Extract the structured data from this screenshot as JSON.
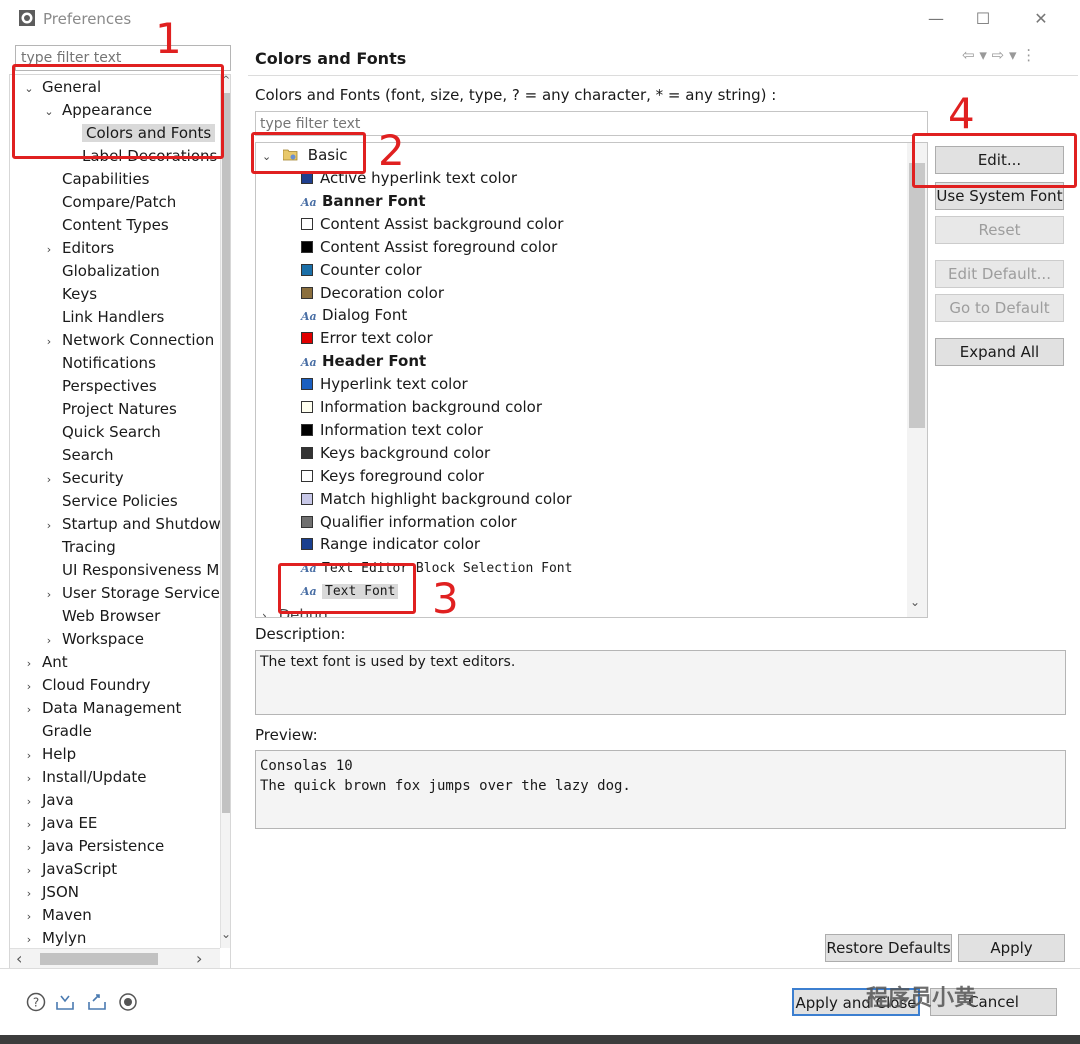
{
  "window": {
    "title": "Preferences",
    "minimize_glyph": "—",
    "maximize_glyph": "☐",
    "close_glyph": "✕",
    "icon": "eclipse-icon"
  },
  "left": {
    "filter_placeholder": "type filter text",
    "tree": [
      {
        "label": "General",
        "depth": 0,
        "toggle": "⌄"
      },
      {
        "label": "Appearance",
        "depth": 1,
        "toggle": "⌄"
      },
      {
        "label": "Colors and Fonts",
        "depth": 2,
        "toggle": "",
        "selected": true
      },
      {
        "label": "Label Decorations",
        "depth": 2,
        "toggle": ""
      },
      {
        "label": "Capabilities",
        "depth": 1,
        "toggle": ""
      },
      {
        "label": "Compare/Patch",
        "depth": 1,
        "toggle": ""
      },
      {
        "label": "Content Types",
        "depth": 1,
        "toggle": ""
      },
      {
        "label": "Editors",
        "depth": 1,
        "toggle": "›"
      },
      {
        "label": "Globalization",
        "depth": 1,
        "toggle": ""
      },
      {
        "label": "Keys",
        "depth": 1,
        "toggle": ""
      },
      {
        "label": "Link Handlers",
        "depth": 1,
        "toggle": ""
      },
      {
        "label": "Network Connection",
        "depth": 1,
        "toggle": "›"
      },
      {
        "label": "Notifications",
        "depth": 1,
        "toggle": ""
      },
      {
        "label": "Perspectives",
        "depth": 1,
        "toggle": ""
      },
      {
        "label": "Project Natures",
        "depth": 1,
        "toggle": ""
      },
      {
        "label": "Quick Search",
        "depth": 1,
        "toggle": ""
      },
      {
        "label": "Search",
        "depth": 1,
        "toggle": ""
      },
      {
        "label": "Security",
        "depth": 1,
        "toggle": "›"
      },
      {
        "label": "Service Policies",
        "depth": 1,
        "toggle": ""
      },
      {
        "label": "Startup and Shutdow",
        "depth": 1,
        "toggle": "›"
      },
      {
        "label": "Tracing",
        "depth": 1,
        "toggle": ""
      },
      {
        "label": "UI Responsiveness M",
        "depth": 1,
        "toggle": ""
      },
      {
        "label": "User Storage Service",
        "depth": 1,
        "toggle": "›"
      },
      {
        "label": "Web Browser",
        "depth": 1,
        "toggle": ""
      },
      {
        "label": "Workspace",
        "depth": 1,
        "toggle": "›"
      },
      {
        "label": "Ant",
        "depth": 0,
        "toggle": "›"
      },
      {
        "label": "Cloud Foundry",
        "depth": 0,
        "toggle": "›"
      },
      {
        "label": "Data Management",
        "depth": 0,
        "toggle": "›"
      },
      {
        "label": "Gradle",
        "depth": 0,
        "toggle": ""
      },
      {
        "label": "Help",
        "depth": 0,
        "toggle": "›"
      },
      {
        "label": "Install/Update",
        "depth": 0,
        "toggle": "›"
      },
      {
        "label": "Java",
        "depth": 0,
        "toggle": "›"
      },
      {
        "label": "Java EE",
        "depth": 0,
        "toggle": "›"
      },
      {
        "label": "Java Persistence",
        "depth": 0,
        "toggle": "›"
      },
      {
        "label": "JavaScript",
        "depth": 0,
        "toggle": "›"
      },
      {
        "label": "JSON",
        "depth": 0,
        "toggle": "›"
      },
      {
        "label": "Maven",
        "depth": 0,
        "toggle": "›"
      },
      {
        "label": "Mylyn",
        "depth": 0,
        "toggle": "›"
      }
    ],
    "scroll_up": "^",
    "scroll_down": "⌄",
    "scroll_left": "‹",
    "scroll_right": "›"
  },
  "main": {
    "title": "Colors and Fonts",
    "nav_glyphs": "⇦ ▾ ⇨ ▾ ⋮",
    "label": "Colors and Fonts (font, size, type, ? = any character, * = any string) :",
    "filter_placeholder": "type filter text",
    "category": {
      "label": "Basic",
      "toggle": "⌄",
      "icon": "folder-icon"
    },
    "items": [
      {
        "label": "Active hyperlink text color",
        "kind": "color",
        "color": "#1f3f8f"
      },
      {
        "label": "Banner Font",
        "kind": "font",
        "bold": true
      },
      {
        "label": "Content Assist background color",
        "kind": "color",
        "color": "#ffffff"
      },
      {
        "label": "Content Assist foreground color",
        "kind": "color",
        "color": "#000000"
      },
      {
        "label": "Counter color",
        "kind": "color",
        "color": "#1a6fa8"
      },
      {
        "label": "Decoration color",
        "kind": "color",
        "color": "#8b6f3e"
      },
      {
        "label": "Dialog Font",
        "kind": "font"
      },
      {
        "label": "Error text color",
        "kind": "color",
        "color": "#e00000"
      },
      {
        "label": "Header Font",
        "kind": "font",
        "bold": true
      },
      {
        "label": "Hyperlink text color",
        "kind": "color",
        "color": "#1b5fc0"
      },
      {
        "label": "Information background color",
        "kind": "color",
        "color": "#fffff0"
      },
      {
        "label": "Information text color",
        "kind": "color",
        "color": "#000000"
      },
      {
        "label": "Keys background color",
        "kind": "color",
        "color": "#333333"
      },
      {
        "label": "Keys foreground color",
        "kind": "color",
        "color": "#ffffff"
      },
      {
        "label": "Match highlight background color",
        "kind": "color",
        "color": "#c8c8e8"
      },
      {
        "label": "Qualifier information color",
        "kind": "color",
        "color": "#707070"
      },
      {
        "label": "Range indicator color",
        "kind": "color",
        "color": "#1a3f8f"
      },
      {
        "label": "Text Editor Block Selection Font",
        "kind": "font",
        "mono": true
      },
      {
        "label": "Text Font",
        "kind": "font",
        "mono": true,
        "selected": true
      }
    ],
    "next_category": {
      "label": "Debug",
      "toggle": "›"
    },
    "scroll_down": "⌄",
    "buttons": {
      "edit": "Edit...",
      "use_system_font": "Use System Font",
      "reset": "Reset",
      "edit_default": "Edit Default...",
      "go_to_default": "Go to Default",
      "expand_all": "Expand All"
    },
    "description_label": "Description:",
    "description_text": "The text font is used by text editors.",
    "preview_label": "Preview:",
    "preview_lines": [
      "Consolas 10",
      "The quick brown fox jumps over the lazy dog."
    ],
    "restore_defaults": "Restore Defaults",
    "apply": "Apply"
  },
  "footer": {
    "apply_and_close": "Apply and Close",
    "cancel": "Cancel",
    "icons": [
      "help-icon",
      "import-icon",
      "export-icon",
      "record-icon"
    ]
  },
  "annotations": [
    "1",
    "2",
    "3",
    "4"
  ],
  "watermark": "程序员小黄"
}
